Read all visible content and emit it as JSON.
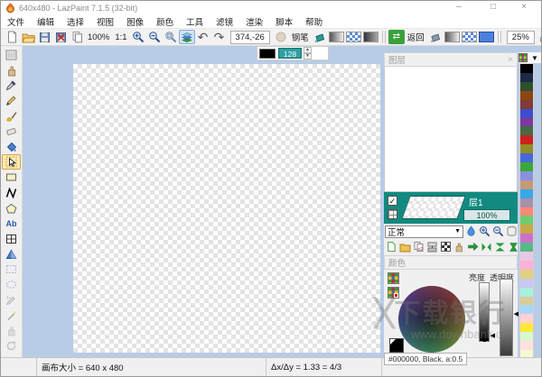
{
  "window": {
    "title": "640x480 - LazPaint 7.1.5 (32-bit)",
    "controls": {
      "minimize": "–",
      "maximize": "□",
      "close": "×"
    }
  },
  "menu": {
    "items": [
      "文件",
      "编辑",
      "选择",
      "视图",
      "图像",
      "颜色",
      "工具",
      "滤镜",
      "渲染",
      "脚本",
      "帮助"
    ]
  },
  "toolbar": {
    "zoom_fit_label": "100%",
    "zoom_one_label": "1:1",
    "cursor_coords": "374,-26",
    "active_tool_label": "钢笔",
    "back_label": "返回",
    "tolerance": "25%",
    "file_icons": [
      "new-document",
      "open-folder",
      "save",
      "save-as",
      "copy"
    ],
    "view_icons": [
      "zoom-in",
      "zoom-out",
      "zoom-fit",
      "show-layers"
    ],
    "history_icons": [
      "undo",
      "redo"
    ],
    "pen_fill_icons": [
      "plain-fill",
      "gradient-fill",
      "texture-fill",
      "pattern-fill"
    ],
    "back_fill_icons": [
      "swap-colors",
      "plain-fill",
      "gradient-fill",
      "texture-fill",
      "solid-fill"
    ],
    "confirm_icon": "thumbs-up"
  },
  "pen_options": {
    "alpha": "128"
  },
  "tools": [
    {
      "name": "toolbox-columns",
      "state": "normal"
    },
    {
      "name": "hand",
      "state": "normal"
    },
    {
      "name": "color-picker",
      "state": "normal"
    },
    {
      "name": "pen",
      "state": "normal"
    },
    {
      "name": "brush",
      "state": "normal"
    },
    {
      "name": "eraser",
      "state": "normal"
    },
    {
      "name": "flood-fill",
      "state": "normal"
    },
    {
      "name": "edit-shapes",
      "state": "active"
    },
    {
      "name": "rectangle",
      "state": "normal"
    },
    {
      "name": "polyline",
      "state": "normal"
    },
    {
      "name": "polygon",
      "state": "normal"
    },
    {
      "name": "text",
      "state": "normal",
      "label": "Ab"
    },
    {
      "name": "deformation-grid",
      "state": "normal"
    },
    {
      "name": "phong-shape",
      "state": "normal"
    },
    {
      "name": "select-rectangle",
      "state": "disabled"
    },
    {
      "name": "select-ellipse",
      "state": "disabled"
    },
    {
      "name": "select-pen",
      "state": "disabled"
    },
    {
      "name": "magic-wand",
      "state": "disabled"
    },
    {
      "name": "move-selection",
      "state": "disabled"
    },
    {
      "name": "rotate-selection",
      "state": "disabled"
    }
  ],
  "layers": {
    "panel_title": "图层",
    "blend_mode": "正常",
    "layer": {
      "name": "层1",
      "opacity": "100%",
      "visible": true
    },
    "blend_icons": [
      "color-droplet",
      "zoom-in",
      "zoom-out",
      "layer-storage"
    ],
    "action_icons": [
      "new-layer",
      "add-layer-from-file",
      "duplicate-layer",
      "merge-layer",
      "rasterize-layer",
      "move-layer",
      "arrow-move",
      "flip-horizontal",
      "flip-vertical",
      "rotate-layer",
      "shape-layer"
    ]
  },
  "colors": {
    "panel_title": "颜色",
    "lightness_label": "亮度",
    "opacity_label": "透明度",
    "current": "#000000, Black, a:0.5"
  },
  "palette": {
    "colors": [
      "#000000",
      "#1b2a45",
      "#2f4f2f",
      "#8b4513",
      "#803a3a",
      "#3a4fd0",
      "#7a3aa0",
      "#456b45",
      "#cc2020",
      "#8f8f26",
      "#4868d8",
      "#3aa83a",
      "#8890e0",
      "#c49a78",
      "#38a8e8",
      "#a890a8",
      "#ff8878",
      "#70cc70",
      "#c8a848",
      "#cc70cc",
      "#58b888",
      "#e8c8e8",
      "#ffb0d8",
      "#e0d080",
      "#c8c8f0",
      "#a8f0e0",
      "#d8cc98",
      "#a8d8f8",
      "#ffd0d8",
      "#ffe838",
      "#d8f8d0",
      "#ffe0e0",
      "#f8f8d0"
    ]
  },
  "status": {
    "canvas_size": "画布大小 = 640 x 480",
    "aspect": "Δx/Δy = 1.33 = 4/3"
  },
  "watermark": {
    "brand": "下载银行",
    "site": "www.downbank.cn"
  }
}
